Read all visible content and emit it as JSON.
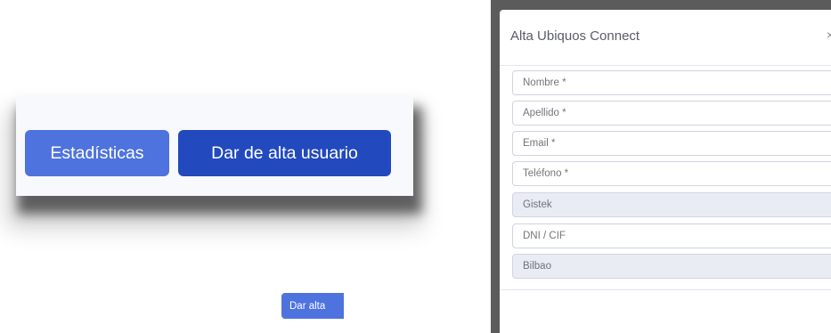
{
  "toolbar": {
    "stats_label": "Estadísticas",
    "add_user_label": "Dar de alta usuario"
  },
  "modal": {
    "title": "Alta Ubiquos Connect",
    "close_label": "×",
    "fields": [
      {
        "placeholder": "Nombre *",
        "value": ""
      },
      {
        "placeholder": "Apellido *",
        "value": ""
      },
      {
        "placeholder": "Email *",
        "value": ""
      },
      {
        "placeholder": "Teléfono *",
        "value": ""
      },
      {
        "placeholder": "",
        "value": "Gistek"
      },
      {
        "placeholder": "DNI / CIF",
        "value": ""
      },
      {
        "placeholder": "",
        "value": "Bilbao"
      }
    ],
    "submit_label": "Dar alta"
  },
  "colors": {
    "primary": "#4e73df",
    "primary_dark": "#224abe",
    "readonly_bg": "#eaecf4",
    "backdrop": "#5b5b5b"
  }
}
